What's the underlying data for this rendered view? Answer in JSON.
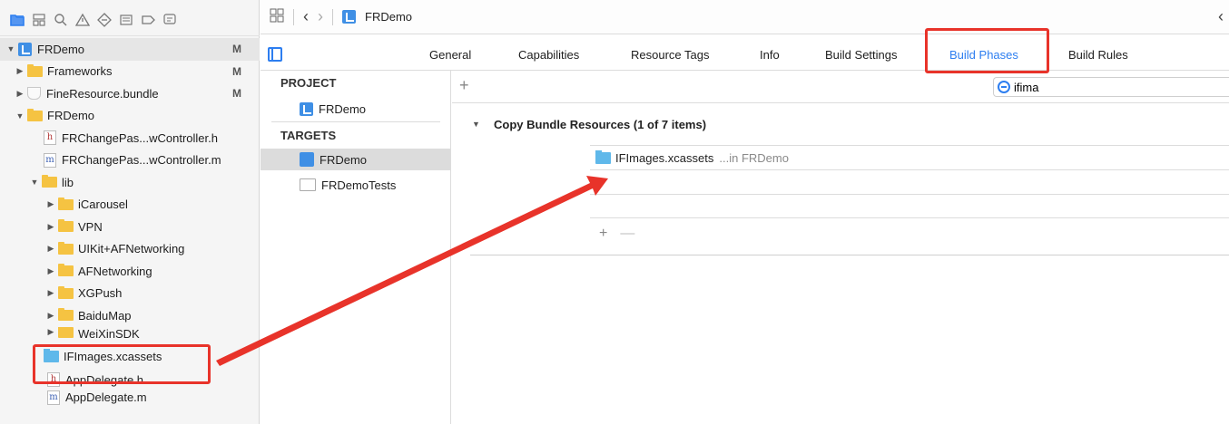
{
  "navigator": {
    "rows": [
      {
        "label": "FRDemo",
        "badge": "M"
      },
      {
        "label": "Frameworks",
        "badge": "M"
      },
      {
        "label": "FineResource.bundle",
        "badge": "M"
      },
      {
        "label": "FRDemo",
        "badge": ""
      },
      {
        "label": "FRChangePas...wController.h",
        "badge": ""
      },
      {
        "label": "FRChangePas...wController.m",
        "badge": ""
      },
      {
        "label": "lib",
        "badge": ""
      },
      {
        "label": "iCarousel",
        "badge": ""
      },
      {
        "label": "VPN",
        "badge": ""
      },
      {
        "label": "UIKit+AFNetworking",
        "badge": ""
      },
      {
        "label": "AFNetworking",
        "badge": ""
      },
      {
        "label": "XGPush",
        "badge": ""
      },
      {
        "label": "BaiduMap",
        "badge": ""
      },
      {
        "label": "WeiXinSDK",
        "badge": ""
      },
      {
        "label": "IFImages.xcassets",
        "badge": ""
      },
      {
        "label": "AppDelegate.h",
        "badge": ""
      },
      {
        "label": "AppDelegate.m",
        "badge": ""
      }
    ],
    "h_glyph": "h",
    "m_glyph": "m"
  },
  "editor": {
    "breadcrumb": "FRDemo",
    "tabs": [
      "General",
      "Capabilities",
      "Resource Tags",
      "Info",
      "Build Settings",
      "Build Phases",
      "Build Rules"
    ],
    "project_header": "PROJECT",
    "project_item": "FRDemo",
    "targets_header": "TARGETS",
    "target_items": [
      "FRDemo",
      "FRDemoTests"
    ],
    "add_symbol": "+",
    "remove_symbol": "—",
    "search_value": "ifima"
  },
  "phase": {
    "title": "Copy Bundle Resources (1 of 7 items)",
    "items": [
      {
        "name": "IFImages.xcassets",
        "location": "...in FRDemo"
      }
    ]
  },
  "colors": {
    "accent": "#2d7ef0",
    "highlight": "#e8332a",
    "folder": "#f5c342"
  }
}
